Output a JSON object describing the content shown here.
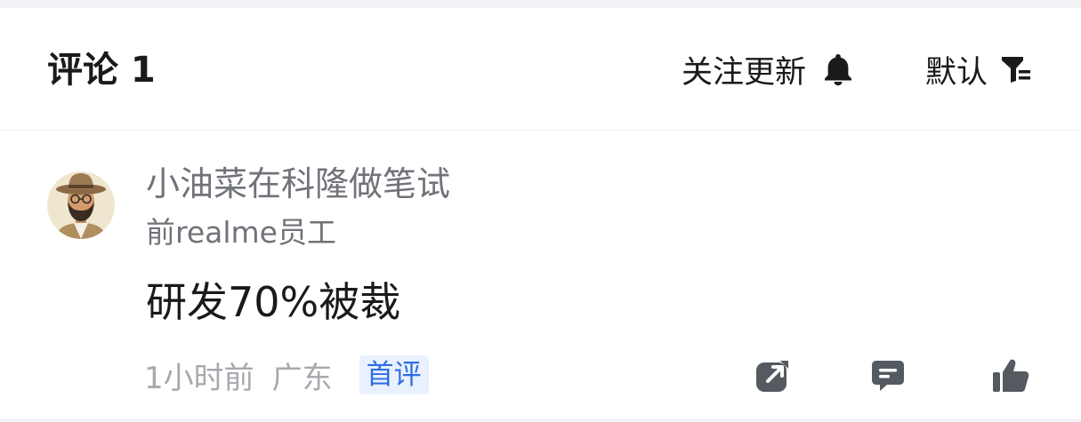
{
  "header": {
    "title": "评论 1",
    "follow_label": "关注更新",
    "follow_icon": "bell-icon",
    "sort_label": "默认",
    "sort_icon": "filter-icon"
  },
  "comment": {
    "avatar_icon": "avatar-man-with-hat",
    "username": "小油菜在科隆做笔试",
    "user_title": "前realme员工",
    "text": "研发70%被裁",
    "time": "1小时前",
    "location": "广东",
    "badge": "首评",
    "actions": {
      "share_icon": "share-icon",
      "reply_icon": "reply-icon",
      "like_icon": "thumbs-up-icon"
    }
  },
  "colors": {
    "title": "#1a1a1a",
    "secondary_text": "#707379",
    "meta_text": "#a6a9ae",
    "badge_bg": "#eaf1fe",
    "badge_text": "#2f6de4",
    "icon": "#555a61",
    "divider": "#f1f2f5"
  }
}
